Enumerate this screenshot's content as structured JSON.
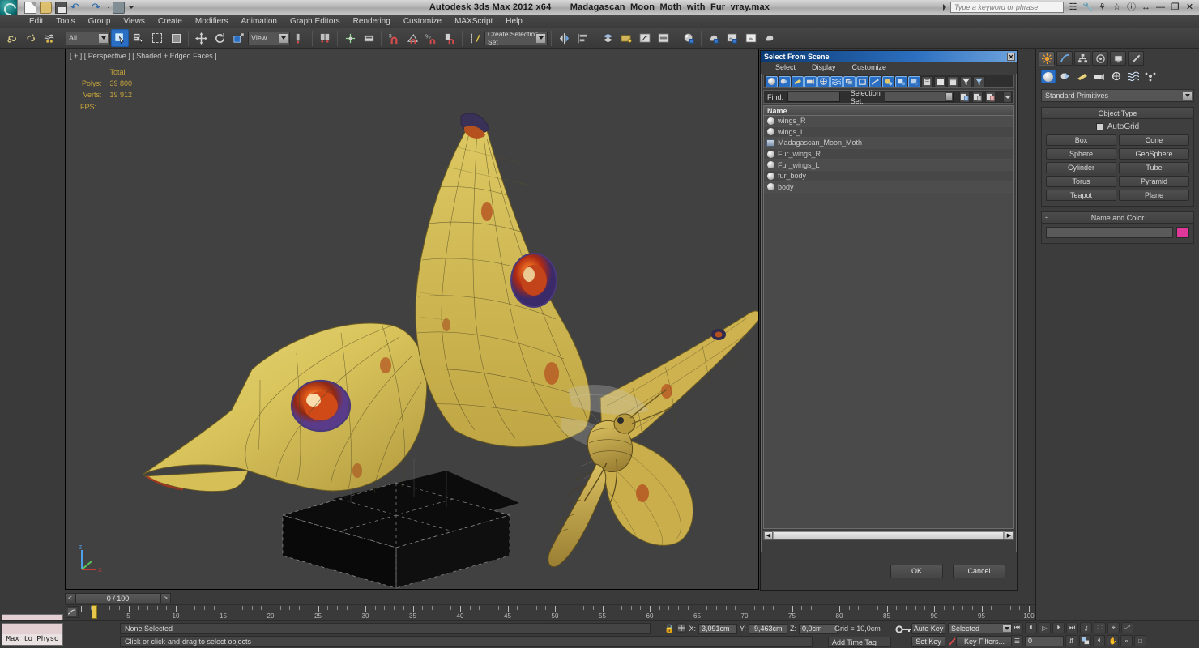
{
  "window": {
    "app_title": "Autodesk 3ds Max  2012 x64",
    "file_name": "Madagascan_Moon_Moth_with_Fur_vray.max",
    "search_placeholder": "Type a keyword or phrase",
    "minimize": "—",
    "restore": "❐",
    "close": "✕"
  },
  "quick_access": {
    "new_icon": "new-file-icon",
    "open_icon": "open-file-icon",
    "save_icon": "save-icon",
    "undo_icon": "undo-icon",
    "redo_icon": "redo-icon",
    "set_icon": "project-set-icon",
    "caret_icon": "chevron-down-icon"
  },
  "menu": {
    "items": [
      "Edit",
      "Tools",
      "Group",
      "Views",
      "Create",
      "Modifiers",
      "Animation",
      "Graph Editors",
      "Rendering",
      "Customize",
      "MAXScript",
      "Help"
    ]
  },
  "toolbar": {
    "selection_filter": "All",
    "coordinate_system": "View",
    "selection_set": "Create Selection Set",
    "icons": [
      "select-and-link-icon",
      "unlink-selection-icon",
      "bind-to-space-warp-icon",
      "select-object-icon",
      "select-by-name-icon",
      "rectangular-selection-region-icon",
      "window-crossing-icon",
      "select-and-move-icon",
      "select-and-rotate-icon",
      "select-and-scale-icon",
      "use-pivot-point-center-icon",
      "mirror-icon",
      "align-icon",
      "snaps-toggle-icon",
      "angle-snap-toggle-icon",
      "percent-snap-toggle-icon",
      "spinner-snap-toggle-icon",
      "named-selection-sets-icon",
      "mirror-tool-icon",
      "align-tool-icon",
      "layer-manager-icon",
      "schematic-view-icon",
      "curve-editor-icon",
      "dope-sheet-icon",
      "material-editor-icon",
      "render-setup-icon",
      "rendered-frame-window-icon",
      "render-production-icon",
      "render-iterative-icon"
    ]
  },
  "viewport": {
    "label": "[ + ] [ Perspective ] [ Shaded + Edged Faces ]",
    "stats_header": "Total",
    "polys_label": "Polys:",
    "polys_value": "39 800",
    "verts_label": "Verts:",
    "verts_value": "19 912",
    "fps_label": "FPS:",
    "fps_value": ""
  },
  "dialog": {
    "title": "Select From Scene",
    "close_label": "✕",
    "menu": [
      "Select",
      "Display",
      "Customize"
    ],
    "filter_icons": [
      "display-geometry-icon",
      "display-shapes-icon",
      "display-lights-icon",
      "display-cameras-icon",
      "display-helpers-icon",
      "display-space-warps-icon",
      "display-groups-icon",
      "display-xrefs-icon",
      "display-bones-icon",
      "display-containers-icon",
      "display-selected-icon",
      "display-unselected-icon",
      "display-all-icon",
      "display-none-icon",
      "display-invert-icon",
      "expand-all-icon",
      "collapse-all-icon"
    ],
    "find_label": "Find:",
    "find_value": "",
    "selection_set_label": "Selection Set:",
    "selection_set_value": "",
    "column_header": "Name",
    "items": [
      {
        "name": "wings_R",
        "icon": "object-sphere-icon"
      },
      {
        "name": "wings_L",
        "icon": "object-sphere-icon"
      },
      {
        "name": "Madagascan_Moon_Moth",
        "icon": "group-icon"
      },
      {
        "name": "Fur_wings_R",
        "icon": "object-sphere-icon"
      },
      {
        "name": "Fur_wings_L",
        "icon": "object-sphere-icon"
      },
      {
        "name": "fur_body",
        "icon": "object-sphere-icon"
      },
      {
        "name": "body",
        "icon": "object-sphere-icon"
      }
    ],
    "ok_label": "OK",
    "cancel_label": "Cancel"
  },
  "command_panel": {
    "tabs": [
      "create-tab",
      "modify-tab",
      "hierarchy-tab",
      "motion-tab",
      "display-tab",
      "utilities-tab"
    ],
    "active_tab": 0,
    "category_icons": [
      "geometry-icon",
      "shapes-icon",
      "lights-icon",
      "cameras-icon",
      "helpers-icon",
      "space-warps-icon",
      "systems-icon"
    ],
    "subcategory": "Standard Primitives",
    "rollouts": [
      {
        "title": "Object Type",
        "autogrid_label": "AutoGrid",
        "buttons": [
          "Box",
          "Cone",
          "Sphere",
          "GeoSphere",
          "Cylinder",
          "Tube",
          "Torus",
          "Pyramid",
          "Teapot",
          "Plane"
        ]
      },
      {
        "title": "Name and Color",
        "name_value": "",
        "color": "#e0379a"
      }
    ]
  },
  "left_toolbar": {
    "max_to_physc": "Max to Physc"
  },
  "timeline": {
    "frame_display": "0 / 100",
    "prev_arrow": "<",
    "next_arrow": ">",
    "ticks": [
      5,
      10,
      15,
      20,
      25,
      30,
      35,
      40,
      45,
      50,
      55,
      60,
      65,
      70,
      75,
      80,
      85,
      90,
      95,
      100
    ]
  },
  "status_bar": {
    "selection_text": "None Selected",
    "prompt_text": "Click or click-and-drag to select objects",
    "x_label": "X:",
    "x_value": "3,091cm",
    "y_label": "Y:",
    "y_value": "-9,463cm",
    "z_label": "Z:",
    "z_value": "0,0cm",
    "grid_text": "Grid = 10,0cm",
    "add_time_tag": "Add Time Tag",
    "auto_key": "Auto Key",
    "set_key": "Set Key",
    "key_mode": "Selected",
    "key_filters": "Key Filters...",
    "frame_value": "0",
    "lock_icon": "lock-selection-icon",
    "absolute_mode_icon": "absolute-relative-mode-icon",
    "key_icon": "key-mode-toggle-icon"
  },
  "playback": {
    "buttons": [
      "go-to-start-icon",
      "previous-frame-icon",
      "play-animation-icon",
      "next-frame-icon",
      "go-to-end-icon",
      "key-mode-toggle-icon",
      "zoom-extents-icon",
      "zoom-region-icon",
      "maximize-viewport-icon"
    ],
    "buttons2": [
      "time-configuration-icon",
      "current-frame-field",
      "spinner-icon",
      "zoom-all-icon",
      "field-of-view-icon",
      "pan-view-icon",
      "orbit-icon",
      "maximize-viewport-toggle-icon"
    ]
  }
}
